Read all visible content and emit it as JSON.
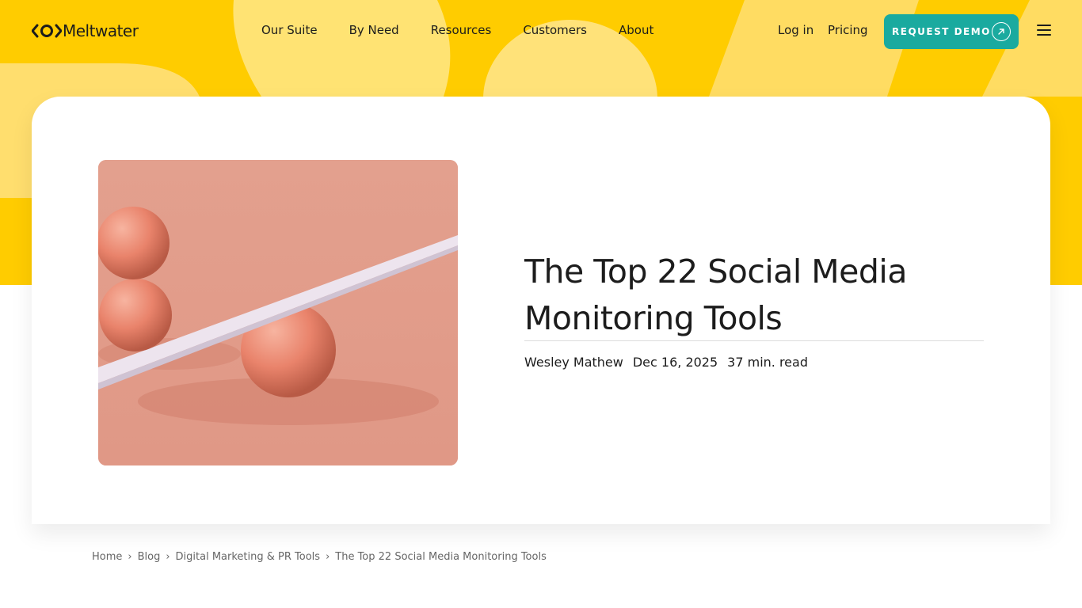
{
  "brand": {
    "name": "Meltwater"
  },
  "nav": {
    "items": [
      {
        "label": "Our Suite"
      },
      {
        "label": "By Need"
      },
      {
        "label": "Resources"
      },
      {
        "label": "Customers"
      },
      {
        "label": "About"
      }
    ],
    "login_label": "Log in",
    "pricing_label": "Pricing",
    "demo_label": "REQUEST DEMO"
  },
  "article": {
    "title_line1": "The Top 22 Social Media",
    "title_line2": "Monitoring Tools",
    "author": "Wesley Mathew",
    "date": "Dec 16, 2025",
    "read_time": "37 min. read"
  },
  "breadcrumb": {
    "items": [
      "Home",
      "Blog",
      "Digital Marketing & PR Tools"
    ],
    "current": "The Top 22 Social Media Monitoring Tools",
    "separator": "›"
  },
  "colors": {
    "hero_yellow": "#ffcc00",
    "hero_shape": "#ffe07a",
    "accent_teal": "#1aaa9f",
    "image_bg": "#e29c8a",
    "text": "#1c1c1c"
  },
  "icons": {
    "logo": "meltwater-logo-icon",
    "demo_arrow": "arrow-up-right-icon",
    "menu": "hamburger-menu-icon"
  }
}
